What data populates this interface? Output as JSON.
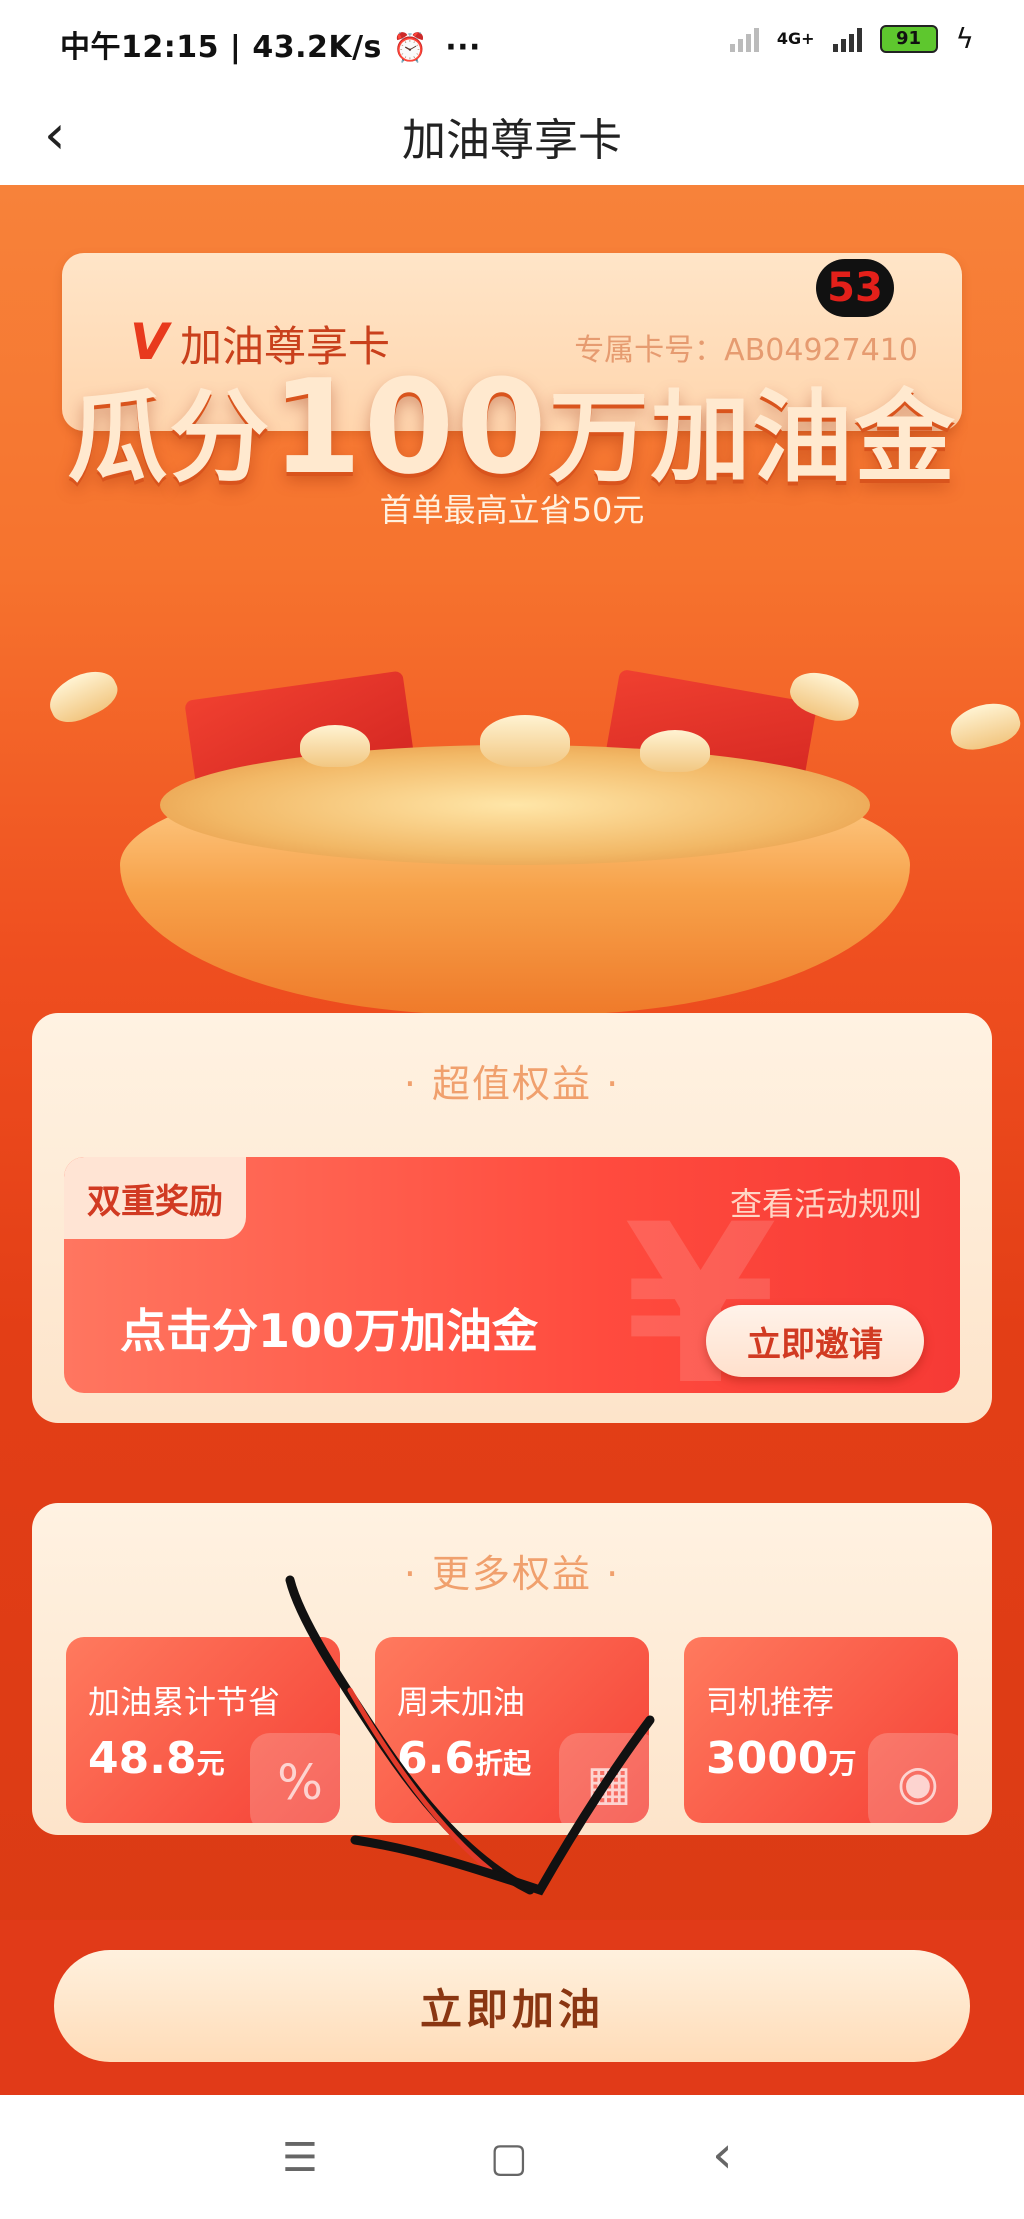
{
  "status_bar": {
    "time_speed": "中午12:15 | 43.2K/s",
    "alarm_icon": "alarm-clock-icon",
    "more": "···",
    "network": "4G+",
    "battery": "91"
  },
  "nav": {
    "back_icon": "chevron-left-icon",
    "title": "加油尊享卡"
  },
  "card": {
    "logo": "V",
    "name": "加油尊享卡",
    "number": "专属卡号：AB04927410"
  },
  "overlay_badge": "53",
  "hero": {
    "title_prefix": "瓜分",
    "title_number": "100",
    "title_suffix": "万加油金",
    "subtitle": "首单最高立省50元"
  },
  "benefits": {
    "section_title": "· 超值权益 ·",
    "banner": {
      "tag": "双重奖励",
      "rules_link": "查看活动规则",
      "text": "点击分100万加油金",
      "button": "立即邀请",
      "deco": "¥"
    }
  },
  "more_benefits": {
    "section_title": "· 更多权益 ·",
    "items": [
      {
        "label": "加油累计节省",
        "value": "48.8",
        "unit": "元",
        "icon": "discount-tag-icon",
        "glyph": "%"
      },
      {
        "label": "周末加油",
        "value": "6.6",
        "unit": "折起",
        "icon": "calendar-icon",
        "glyph": "▦"
      },
      {
        "label": "司机推荐",
        "value": "3000",
        "unit": "万",
        "icon": "driver-icon",
        "glyph": "◉"
      }
    ]
  },
  "cta": {
    "label": "立即加油"
  },
  "system_nav": {
    "menu": "☰",
    "home": "▢",
    "back": "‹"
  }
}
